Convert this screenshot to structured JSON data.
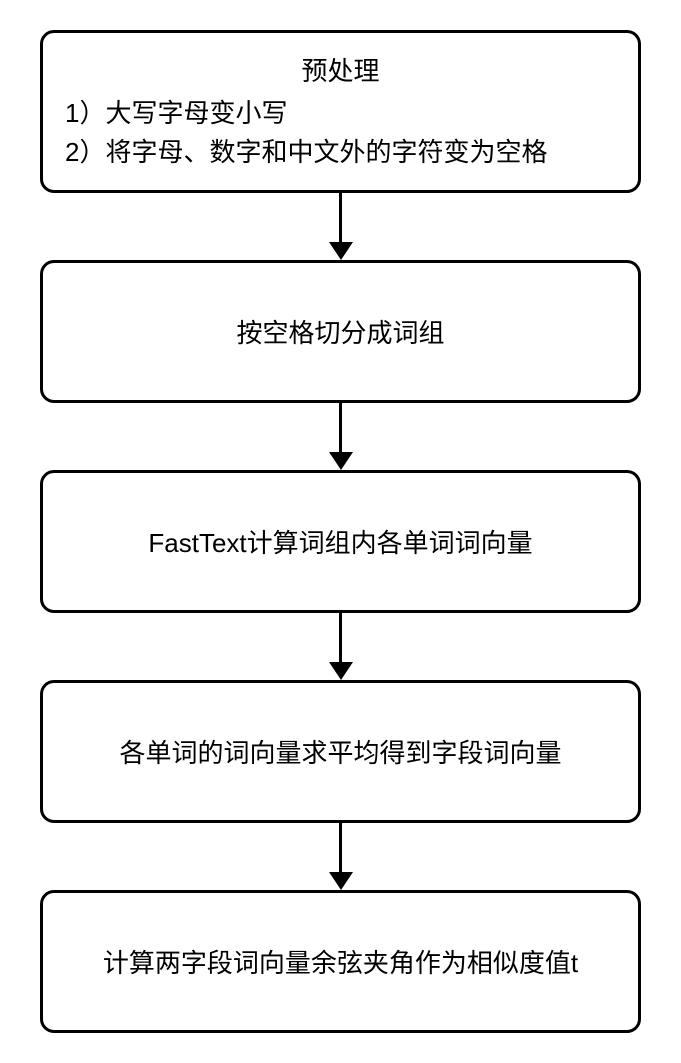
{
  "flowchart": {
    "steps": [
      {
        "type": "multiline",
        "title": "预处理",
        "lines": [
          "1）大写字母变小写",
          "2）将字母、数字和中文外的字符变为空格"
        ]
      },
      {
        "type": "center",
        "text": "按空格切分成词组"
      },
      {
        "type": "center",
        "text": "FastText计算词组内各单词词向量"
      },
      {
        "type": "center",
        "text": "各单词的词向量求平均得到字段词向量"
      },
      {
        "type": "center",
        "text": "计算两字段词向量余弦夹角作为相似度值t"
      }
    ]
  }
}
